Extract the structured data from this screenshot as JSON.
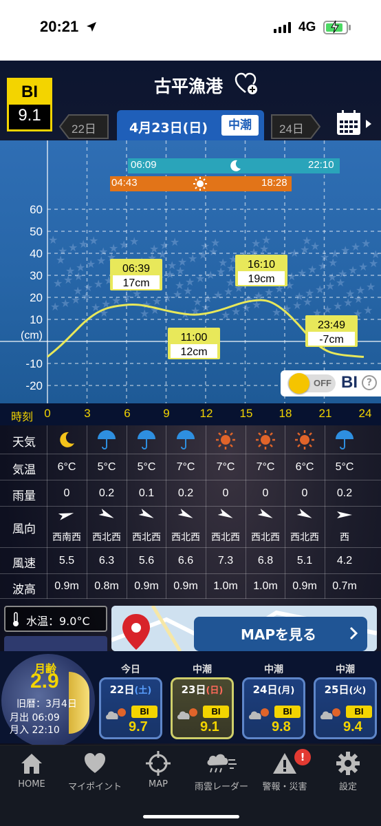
{
  "status_bar": {
    "time": "20:21",
    "network": "4G"
  },
  "header": {
    "bi_label": "BI",
    "bi_value": "9.1",
    "port_name": "古平漁港",
    "prev_date": "22日",
    "current_date": "4月23日(日)",
    "tide_type": "中潮",
    "next_date": "24日"
  },
  "sun_moon": {
    "moonrise": "06:09",
    "moonset": "22:10",
    "sunrise": "04:43",
    "sunset": "18:28"
  },
  "chart_data": {
    "type": "line",
    "ylabel": "(cm)",
    "ylim": [
      -25,
      65
    ],
    "xlim": [
      0,
      24
    ],
    "y_ticks": [
      "60",
      "50",
      "40",
      "30",
      "20",
      "10",
      "-10",
      "-20"
    ],
    "x": [
      0,
      1,
      2,
      3,
      4,
      5,
      6.65,
      8,
      9,
      10,
      11,
      12,
      13,
      14,
      15,
      16.17,
      17,
      18,
      19,
      20,
      21,
      22,
      23.82,
      24
    ],
    "series": [
      {
        "values": [
          -7,
          -2,
          4,
          10,
          14,
          16,
          17,
          15.5,
          14,
          12.8,
          12,
          12.5,
          14,
          16,
          18,
          19,
          18,
          14,
          8,
          1,
          -4,
          -6,
          -7,
          -7
        ]
      }
    ],
    "annotations": [
      {
        "time": "06:39",
        "value": "17cm"
      },
      {
        "time": "11:00",
        "value": "12cm"
      },
      {
        "time": "16:10",
        "value": "19cm"
      },
      {
        "time": "23:49",
        "value": "-7cm"
      }
    ],
    "grid": true
  },
  "bi_toggle": {
    "state": "OFF",
    "label": "BI",
    "help": "?"
  },
  "time_row": {
    "title": "時刻",
    "ticks": [
      "0",
      "3",
      "6",
      "9",
      "12",
      "15",
      "18",
      "21",
      "24"
    ]
  },
  "table": {
    "labels": {
      "weather": "天気",
      "temp": "気温",
      "rain": "雨量",
      "wind_dir": "風向",
      "wind_speed": "風速",
      "wave": "波高"
    },
    "weather": [
      "moon",
      "umbrella",
      "umbrella",
      "umbrella",
      "sun",
      "sun",
      "sun",
      "umbrella"
    ],
    "temp": [
      "6°C",
      "5°C",
      "5°C",
      "7°C",
      "7°C",
      "7°C",
      "6°C",
      "5°C"
    ],
    "rain": [
      "0",
      "0.2",
      "0.1",
      "0.2",
      "0",
      "0",
      "0",
      "0.2"
    ],
    "wind_dir": [
      "西南西",
      "西北西",
      "西北西",
      "西北西",
      "西北西",
      "西北西",
      "西北西",
      "西"
    ],
    "wind_speed": [
      "5.5",
      "6.3",
      "5.6",
      "6.6",
      "7.3",
      "6.8",
      "5.1",
      "4.2"
    ],
    "wave": [
      "0.9m",
      "0.8m",
      "0.9m",
      "0.9m",
      "1.0m",
      "1.0m",
      "0.9m",
      "0.7m"
    ]
  },
  "water_temp": {
    "label": "水温：9.0°C"
  },
  "map": {
    "button_label": "MAPを見る"
  },
  "moon": {
    "age_label": "月齢",
    "age_value": "2.9",
    "lunar_date": "旧暦：3月4日",
    "moonrise": "月出 06:09",
    "moonset": "月入 22:10"
  },
  "days": [
    {
      "label": "今日",
      "date": "22日",
      "dow": "(土)",
      "bi": "BI",
      "value": "9.7"
    },
    {
      "label": "中潮",
      "date": "23日",
      "dow": "(日)",
      "bi": "BI",
      "value": "9.1"
    },
    {
      "label": "中潮",
      "date": "24日",
      "dow": "(月)",
      "bi": "BI",
      "value": "9.8"
    },
    {
      "label": "中潮",
      "date": "25日",
      "dow": "(火)",
      "bi": "BI",
      "value": "9.4"
    }
  ],
  "tabs": [
    {
      "label": "HOME"
    },
    {
      "label": "マイポイント"
    },
    {
      "label": "MAP"
    },
    {
      "label": "雨雲レーダー"
    },
    {
      "label": "警報・災害"
    },
    {
      "label": "設定"
    }
  ],
  "alert_badge": "!",
  "colors": {
    "accent_yellow": "#f3d400",
    "header_blue": "#1f5fb9",
    "sun_orange": "#e27418",
    "moon_teal": "#2aa4ba",
    "tide_line": "#e8e85a"
  }
}
